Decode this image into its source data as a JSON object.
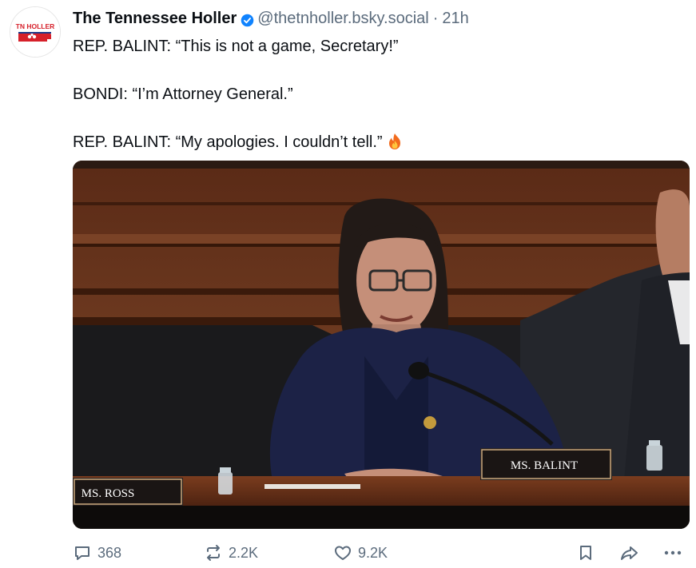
{
  "post": {
    "author_name": "The Tennessee Holler",
    "handle": "@thetnholler.bsky.social",
    "separator": "·",
    "timestamp": "21h",
    "avatar_text": "TN HOLLER",
    "lines": [
      "REP. BALINT: “This is not a game, Secretary!”",
      "BONDI: “I’m Attorney General.”",
      "REP. BALINT: “My apologies. I couldn’t tell.”"
    ],
    "emoji": "fire-emoji"
  },
  "media": {
    "nameplate_left": "MS. ROSS",
    "nameplate_right": "MS. BALINT"
  },
  "actions": {
    "replies": "368",
    "reposts": "2.2K",
    "likes": "9.2K"
  },
  "colors": {
    "text": "#0b0f14",
    "muted": "#5b6b7c",
    "verified": "#1083fe",
    "brand_red": "#d6202a"
  },
  "icons": [
    "verified-badge-icon",
    "fire-icon",
    "reply-icon",
    "repost-icon",
    "like-icon",
    "bookmark-icon",
    "share-icon",
    "more-icon"
  ]
}
